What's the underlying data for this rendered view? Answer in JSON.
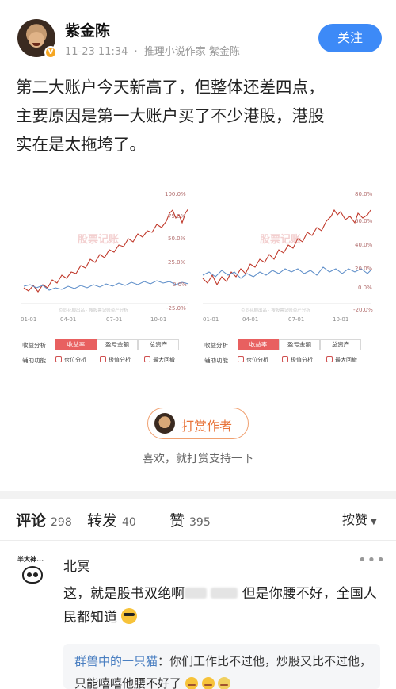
{
  "author": {
    "name": "紫金陈",
    "verified_badge": "V",
    "timestamp": "11-23 11:34",
    "separator": "·",
    "description": "推理小说作家 紫金陈",
    "follow_label": "关注"
  },
  "post": {
    "lines": [
      "第二大账户今天新高了，但整体还差四点，",
      "主要原因是第一大账户买了不少港股，港股",
      "实在是太拖垮了。"
    ]
  },
  "chart_image": {
    "watermark": "股票记账",
    "left_panel": {
      "y_ticks": [
        "100.0%",
        "75.0%",
        "50.0%",
        "25.0%",
        "0.0%",
        "-25.0%"
      ],
      "x_ticks": [
        "01-01",
        "04-01",
        "07-01",
        "10-01"
      ],
      "small_watermark": "©同花顺出品 · 搜股票记账资产分析",
      "controls": {
        "row1_label": "收益分析",
        "tabs": [
          "收益率",
          "盈亏金额",
          "总资产"
        ],
        "row2_label": "辅助功能",
        "checks": [
          "仓位分析",
          "极值分析",
          "最大回撤"
        ]
      }
    },
    "right_panel": {
      "y_ticks": [
        "80.0%",
        "60.0%",
        "40.0%",
        "20.0%",
        "0.0%",
        "-20.0%"
      ],
      "x_ticks": [
        "01-01",
        "04-01",
        "07-01",
        "10-01"
      ],
      "small_watermark": "©同花顺出品 · 搜股票记账资产分析",
      "controls": {
        "row1_label": "收益分析",
        "tabs": [
          "收益率",
          "盈亏金额",
          "总资产"
        ],
        "row2_label": "辅助功能",
        "checks": [
          "仓位分析",
          "极值分析",
          "最大回撤"
        ]
      }
    },
    "colors": {
      "portfolio_line": "#c0392b",
      "benchmark_line": "#5b8cc8",
      "active_tab": "#e86060"
    }
  },
  "tip": {
    "button_label": "打赏作者",
    "subtitle": "喜欢，就打赏支持一下"
  },
  "stats": {
    "comments_label": "评论",
    "comments_count": "298",
    "reposts_label": "转发",
    "reposts_count": "40",
    "likes_label": "赞",
    "likes_count": "395",
    "sort_label": "按赞"
  },
  "comment": {
    "avatar_caption": "半大神...",
    "user": "北冥",
    "more": "•••",
    "text_before": "这，就是股书双绝啊",
    "text_after": " 但是你腰不好，全国人民都知道",
    "reply": {
      "user": "群兽中的一只猫",
      "text": "：你们工作比不过他，炒股又比不过他，只能嘻嘻他腰不好了"
    }
  }
}
